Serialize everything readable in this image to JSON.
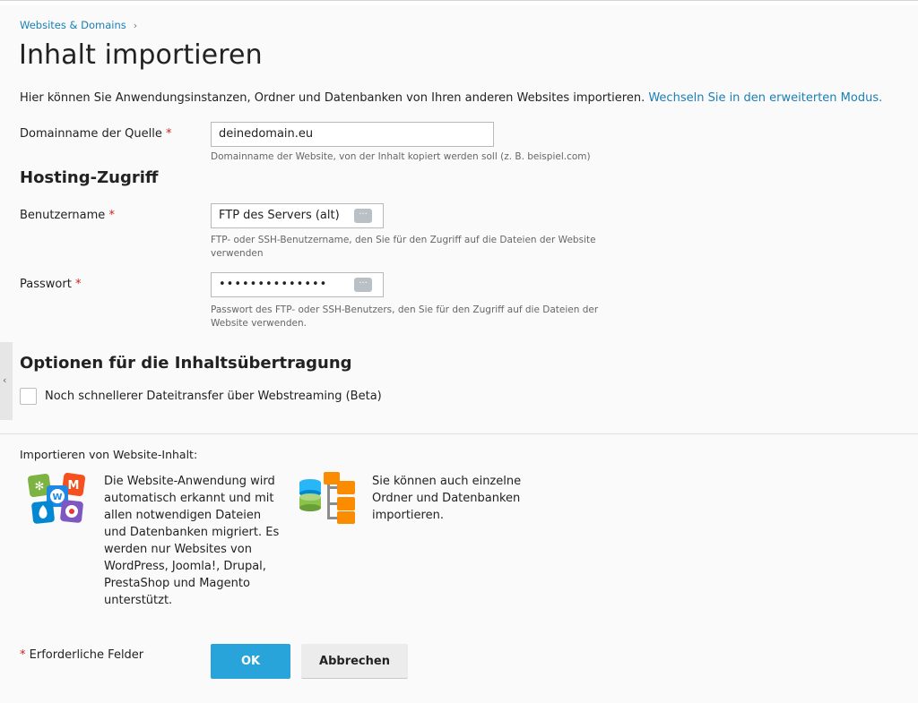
{
  "breadcrumb": {
    "item": "Websites & Domains",
    "separator": "›"
  },
  "page_title": "Inhalt importieren",
  "intro": {
    "text": "Hier können Sie Anwendungsinstanzen, Ordner und Datenbanken von Ihren anderen Websites importieren. ",
    "link": "Wechseln Sie in den erweiterten Modus."
  },
  "form": {
    "source_domain": {
      "label": "Domainname der Quelle",
      "required_mark": "*",
      "value": "deinedomain.eu",
      "hint": "Domainname der Website, von der Inhalt kopiert werden soll (z. B. beispiel.com)"
    },
    "hosting_heading": "Hosting-Zugriff",
    "username": {
      "label": "Benutzername",
      "required_mark": "*",
      "value": "FTP des Servers (alt)",
      "hint": "FTP- oder SSH-Benutzername, den Sie für den Zugriff auf die Dateien der Website verwenden"
    },
    "password": {
      "label": "Passwort",
      "required_mark": "*",
      "value": "••••••••••••••",
      "hint": "Passwort des FTP- oder SSH-Benutzers, den Sie für den Zugriff auf die Dateien der Website verwenden."
    },
    "options_heading": "Optionen für die Inhaltsübertragung",
    "webstreaming": {
      "label": "Noch schnellerer Dateitransfer über Webstreaming (Beta)",
      "checked": false
    },
    "field_action_glyph": "···"
  },
  "import_info": {
    "heading": "Importieren von Website-Inhalt:",
    "apps_text": "Die Website-Anwendung wird automatisch erkannt und mit allen notwendigen Dateien und Datenbanken migriert. Es werden nur Websites von WordPress, Joomla!, Drupal, PrestaShop und Magento unterstützt.",
    "folders_text": "Sie können auch einzelne Ordner und Datenbanken importieren."
  },
  "footer": {
    "required_mark": "*",
    "required_note": "Erforderliche Felder",
    "ok_label": "OK",
    "cancel_label": "Abbrechen"
  },
  "side_tab_glyph": "‹",
  "colors": {
    "link": "#1a7fb5",
    "primary_button": "#28a4db",
    "required": "#d02020"
  }
}
